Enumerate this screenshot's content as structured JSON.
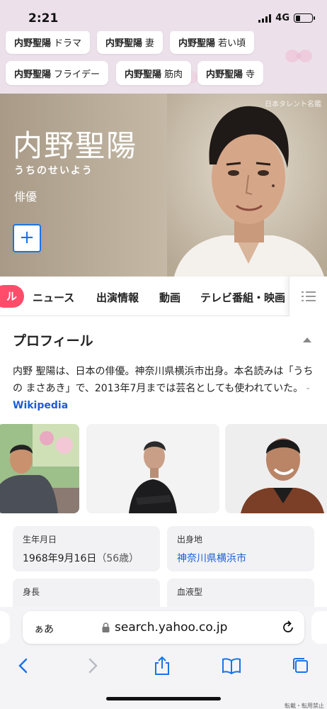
{
  "status_bar": {
    "time": "2:21",
    "network": "4G",
    "battery_level": 0.3
  },
  "suggestions": {
    "row1": [
      {
        "query": "内野聖陽",
        "term": "ドラマ"
      },
      {
        "query": "内野聖陽",
        "term": "妻"
      },
      {
        "query": "内野聖陽",
        "term": "若い頃"
      }
    ],
    "row2": [
      {
        "query": "内野聖陽",
        "term": "フライデー"
      },
      {
        "query": "内野聖陽",
        "term": "筋肉"
      },
      {
        "query": "内野聖陽",
        "term": "寺"
      }
    ]
  },
  "hero": {
    "name": "内野聖陽",
    "reading": "うちのせいよう",
    "occupation": "俳優",
    "add_label": "+",
    "credit": "日本タレント名鑑"
  },
  "tabs": {
    "active": "ル",
    "items": [
      "ニュース",
      "出演情報",
      "動画",
      "テレビ番組・映画"
    ],
    "menu_icon": "list-icon"
  },
  "profile": {
    "heading": "プロフィール",
    "description": "内野 聖陽は、日本の俳優。神奈川県横浜市出身。本名読みは「うちの まさあき」で、2013年7月までは芸名としても使われていた。",
    "source_dash": "-",
    "source": "Wikipedia",
    "facts": [
      {
        "label": "生年月日",
        "value": "1968年9月16日",
        "extra": "（56歳）"
      },
      {
        "label": "出身地",
        "value": "神奈川県横浜市"
      },
      {
        "label": "身長",
        "value": ""
      },
      {
        "label": "血液型",
        "value": ""
      }
    ]
  },
  "browser": {
    "text_size": "ぁあ",
    "url": "search.yahoo.co.jp"
  },
  "footer_note": "転載・転用禁止",
  "colors": {
    "accent": "#1a73e8",
    "tab_active": "#ff4c6a",
    "link": "#1a5ed6",
    "chip_bg": "#ece1ea"
  }
}
